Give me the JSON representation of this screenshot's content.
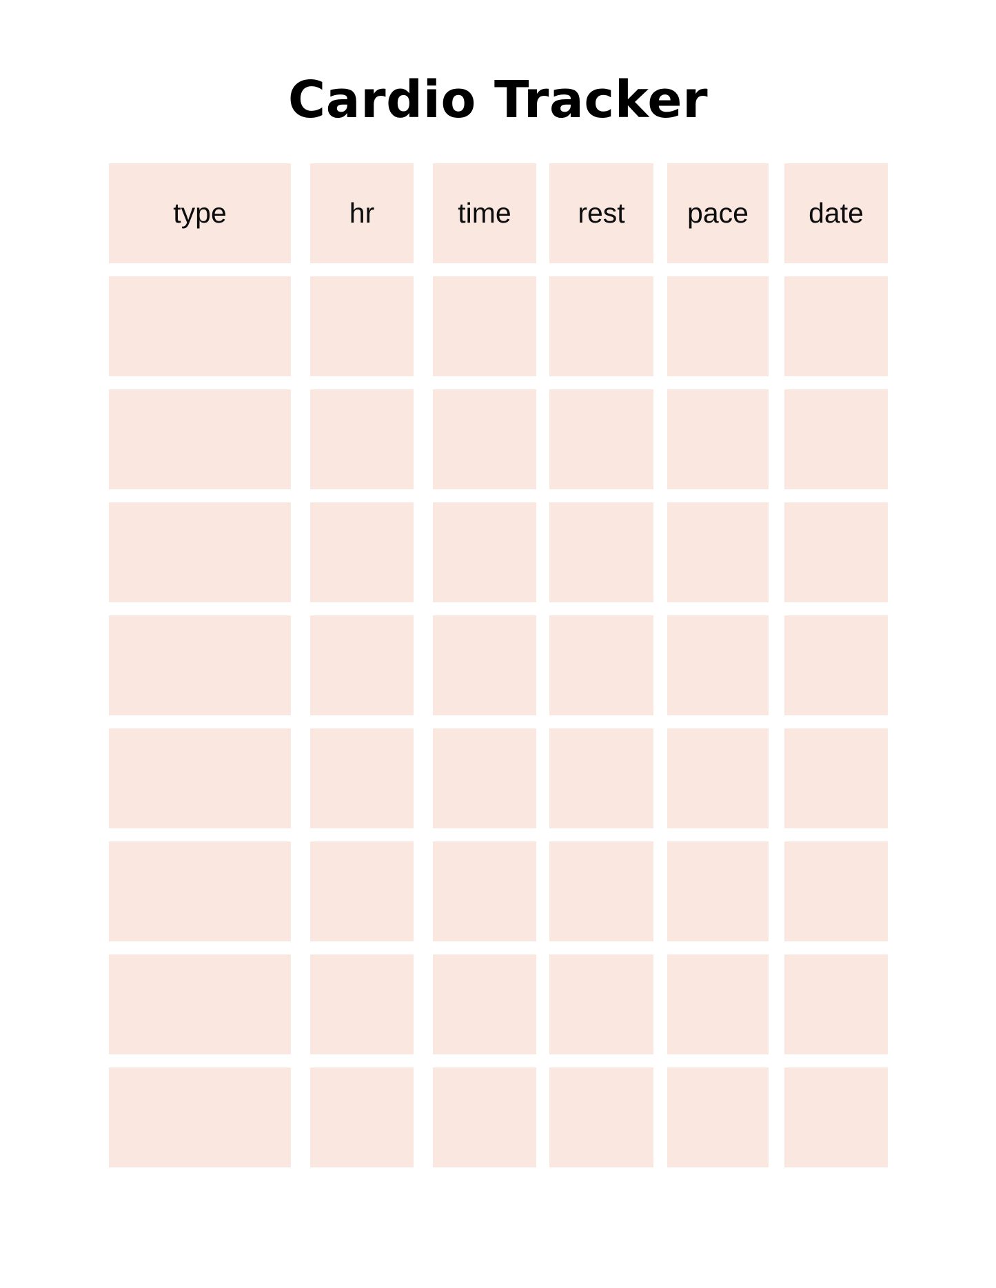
{
  "page": {
    "title": "Cardio Tracker",
    "background_color": "#FFFFFF",
    "cell_color": "#FAE8E0",
    "text_color": "#000000"
  },
  "table": {
    "columns": [
      {
        "key": "type",
        "label": "type"
      },
      {
        "key": "hr",
        "label": "hr"
      },
      {
        "key": "time",
        "label": "time"
      },
      {
        "key": "rest",
        "label": "rest"
      },
      {
        "key": "pace",
        "label": "pace"
      },
      {
        "key": "date",
        "label": "date"
      }
    ],
    "row_count": 8,
    "rows": [
      {
        "type": "",
        "hr": "",
        "time": "",
        "rest": "",
        "pace": "",
        "date": ""
      },
      {
        "type": "",
        "hr": "",
        "time": "",
        "rest": "",
        "pace": "",
        "date": ""
      },
      {
        "type": "",
        "hr": "",
        "time": "",
        "rest": "",
        "pace": "",
        "date": ""
      },
      {
        "type": "",
        "hr": "",
        "time": "",
        "rest": "",
        "pace": "",
        "date": ""
      },
      {
        "type": "",
        "hr": "",
        "time": "",
        "rest": "",
        "pace": "",
        "date": ""
      },
      {
        "type": "",
        "hr": "",
        "time": "",
        "rest": "",
        "pace": "",
        "date": ""
      },
      {
        "type": "",
        "hr": "",
        "time": "",
        "rest": "",
        "pace": "",
        "date": ""
      },
      {
        "type": "",
        "hr": "",
        "time": "",
        "rest": "",
        "pace": "",
        "date": ""
      }
    ]
  }
}
